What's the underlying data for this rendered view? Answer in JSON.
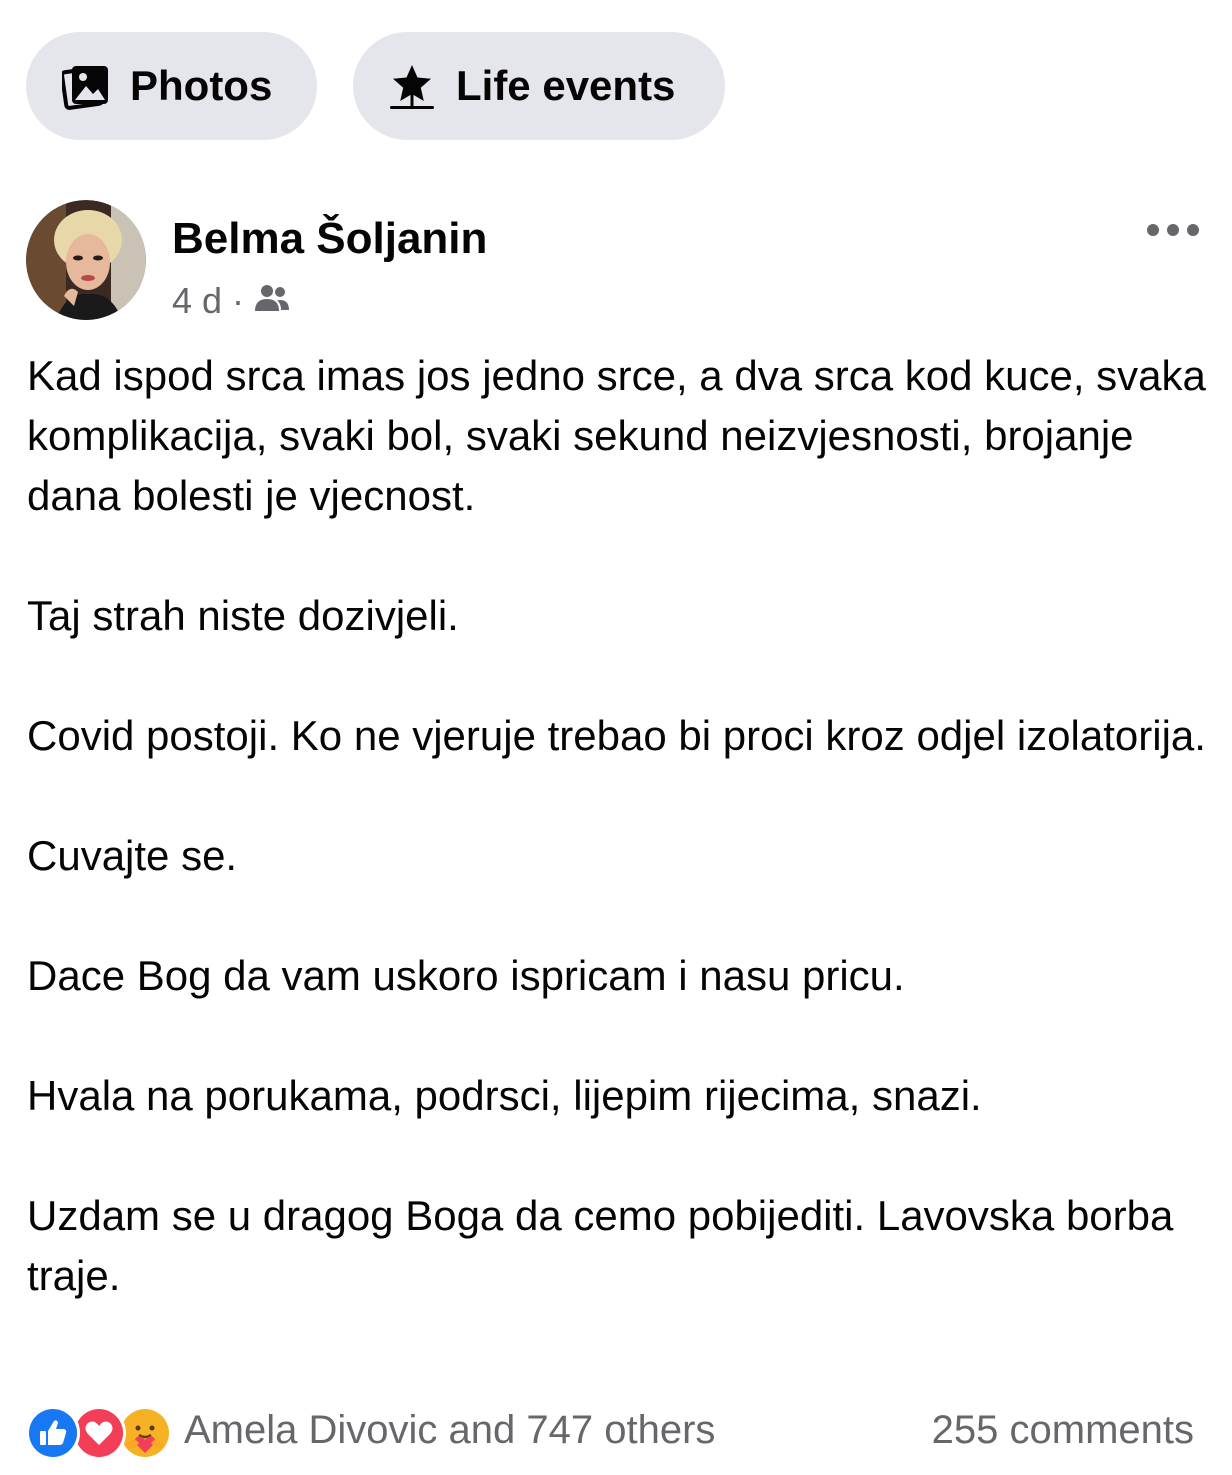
{
  "filters": {
    "photos_label": "Photos",
    "photos_icon": "photos-icon",
    "life_events_label": "Life events",
    "life_events_icon": "star-icon"
  },
  "post": {
    "author": "Belma Šoljanin",
    "time": "4 d",
    "separator": "·",
    "audience_icon": "friends-icon",
    "paragraphs": [
      "Kad ispod srca imas jos jedno srce, a dva srca kod kuce, svaka komplikacija, svaki bol, svaki sekund neizvjesnosti, brojanje dana bolesti je vjecnost.",
      "Taj strah niste dozivjeli.",
      "Covid postoji. Ko ne vjeruje trebao bi proci kroz odjel izolatorija.",
      "Cuvajte se.",
      "Dace Bog da vam uskoro ispricam i nasu pricu.",
      "Hvala na porukama, podrsci, lijepim rijecima, snazi.",
      "Uzdam se u dragog Boga da cemo pobijediti. Lavovska borba traje."
    ]
  },
  "footer": {
    "reactions_text": "Amela Divovic and 747 others",
    "reaction_icons": [
      "like-icon",
      "love-icon",
      "care-icon"
    ],
    "comments_text": "255 comments"
  },
  "colors": {
    "pill_bg": "#e4e6eb",
    "secondary_text": "#65676b",
    "like_blue": "#1877f2",
    "love_red": "#f33e58",
    "care_yellow": "#f7b125"
  }
}
